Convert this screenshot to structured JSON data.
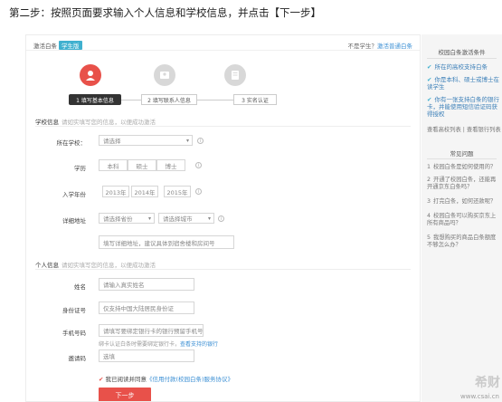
{
  "caption": "第二步：按照页面要求输入个人信息和学校信息，并点击【下一步】",
  "header": {
    "title": "激活白条",
    "tag": "学生版",
    "not_student": "不是学生？",
    "switch_link": "激活普通白条"
  },
  "steps": [
    {
      "label": "1 填写基本信息",
      "active": true
    },
    {
      "label": "2 填写联系人信息",
      "active": false
    },
    {
      "label": "3 实名认证",
      "active": false
    }
  ],
  "school_section": {
    "title": "学校信息",
    "hint": "请如实填写您的信息，以便成功激活"
  },
  "school_field": {
    "label": "所在学校：",
    "placeholder": "请选择"
  },
  "degree_field": {
    "label": "学历",
    "options": [
      "本科",
      "硕士",
      "博士"
    ]
  },
  "year_field": {
    "label": "入学年份",
    "options": [
      "2013年",
      "2014年",
      "2015年"
    ]
  },
  "address_field": {
    "label": "详细地址",
    "province": "请选择省份",
    "city": "请选择城市",
    "detail_placeholder": "填写详细地址，建议具体到宿舍楼和房间号"
  },
  "personal_section": {
    "title": "个人信息",
    "hint": "请如实填写您的信息，以便成功激活"
  },
  "name_field": {
    "label": "姓名",
    "placeholder": "请输入真实姓名"
  },
  "id_field": {
    "label": "身份证号",
    "placeholder": "仅支持中国大陆居民身份证"
  },
  "phone_field": {
    "label": "手机号码",
    "placeholder": "请填写要绑定银行卡的银行预留手机号",
    "note": "绑卡认证白条时需要绑定银行卡，",
    "note_link": "查看支持的银行"
  },
  "invite_field": {
    "label": "邀请码",
    "placeholder": "选填"
  },
  "agreement": {
    "check": "✔",
    "text": "我已阅读并同意",
    "link": "《信用付款(校园白条)服务协议》"
  },
  "next_button": "下一步",
  "sidebar": {
    "conditions_title": "校园白条激活条件",
    "conditions": [
      "所在的高校支持白条",
      "你是本科、硕士或博士在读学生",
      "你有一张支持白条的银行卡，并能使用短信验证码获得授权"
    ],
    "links": "查看高校列表 | 查看银行列表",
    "faq_title": "常见问题",
    "faq": [
      "校园白条是如何使用的？",
      "开通了校园白条，还能再开通京东白条吗？",
      "打完白条，如何还款呢？",
      "校园白条可以购买京东上所有商品吗？",
      "我想购买的商品白条额度不够怎么办？"
    ],
    "watermark": "希财",
    "watermark_url": "www.csai.cn"
  },
  "colors": {
    "accent": "#e8514a",
    "tag": "#3fb0cf",
    "link": "#3b8fd4"
  }
}
